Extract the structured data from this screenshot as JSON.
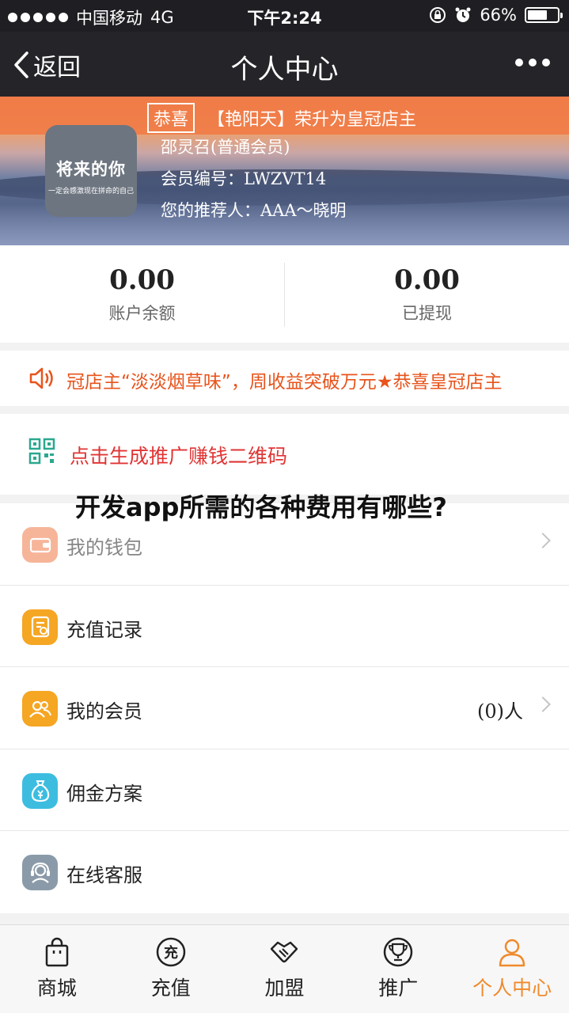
{
  "status_bar": {
    "carrier": "中国移动",
    "network": "4G",
    "time": "下午2:24",
    "battery_percent": "66%",
    "battery_level": 0.66
  },
  "nav": {
    "back_label": "返回",
    "title": "个人中心"
  },
  "notice": {
    "tag": "恭喜",
    "text": "【艳阳天】荣升为皇冠店主"
  },
  "avatar": {
    "big_text": "将来的你",
    "small_text": "一定会感激现在拼命的自己"
  },
  "profile": {
    "name": "邵灵召(普通会员)",
    "member_id": "会员编号：LWZVT14",
    "referrer": "您的推荐人：AAA～晓明"
  },
  "balance": {
    "account_value": "0.00",
    "account_label": "账户余额",
    "withdrawn_value": "0.00",
    "withdrawn_label": "已提现"
  },
  "marquee_text": "冠店主“淡淡烟草味”，周收益突破万元★恭喜皇冠店主",
  "qr_promo": "点击生成推广赚钱二维码",
  "headline": "开发app所需的各种费用有哪些?",
  "menu": {
    "wallet": "我的钱包",
    "recharge_record": "充值记录",
    "members": "我的会员",
    "members_count": "(0)人",
    "commission": "佣金方案",
    "support": "在线客服"
  },
  "colors": {
    "accent": "#f08a2c",
    "notice_bg": "#f07a46",
    "promo_text": "#e03535",
    "marquee_text": "#e8541c"
  },
  "tabs": {
    "mall": "商城",
    "recharge": "充值",
    "join": "加盟",
    "promote": "推广",
    "profile": "个人中心",
    "recharge_glyph": "充"
  }
}
